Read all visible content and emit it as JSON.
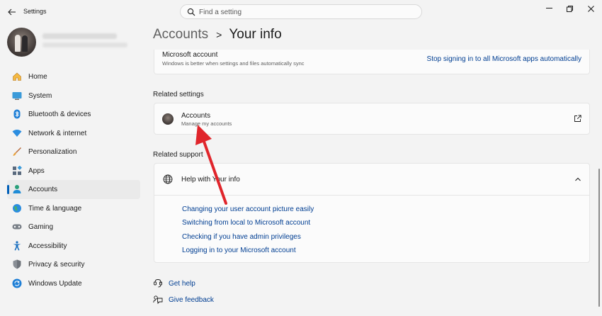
{
  "window": {
    "title": "Settings"
  },
  "search": {
    "placeholder": "Find a setting"
  },
  "sidebar": {
    "items": [
      {
        "label": "Home",
        "icon": "home-icon"
      },
      {
        "label": "System",
        "icon": "system-icon"
      },
      {
        "label": "Bluetooth & devices",
        "icon": "bluetooth-icon"
      },
      {
        "label": "Network & internet",
        "icon": "network-icon"
      },
      {
        "label": "Personalization",
        "icon": "brush-icon"
      },
      {
        "label": "Apps",
        "icon": "apps-icon"
      },
      {
        "label": "Accounts",
        "icon": "accounts-icon",
        "active": true
      },
      {
        "label": "Time & language",
        "icon": "time-language-icon"
      },
      {
        "label": "Gaming",
        "icon": "gaming-icon"
      },
      {
        "label": "Accessibility",
        "icon": "accessibility-icon"
      },
      {
        "label": "Privacy & security",
        "icon": "shield-icon"
      },
      {
        "label": "Windows Update",
        "icon": "update-icon"
      }
    ]
  },
  "breadcrumb": {
    "parent": "Accounts",
    "separator": ">",
    "current": "Your info"
  },
  "microsoft_account": {
    "title": "Microsoft account",
    "description": "Windows is better when settings and files automatically sync",
    "link": "Stop signing in to all Microsoft apps automatically"
  },
  "related_settings": {
    "heading": "Related settings",
    "accounts_card": {
      "title": "Accounts",
      "subtitle": "Manage my accounts"
    }
  },
  "related_support": {
    "heading": "Related support",
    "help": {
      "title": "Help with Your info",
      "links": [
        "Changing your user account picture easily",
        "Switching from local to Microsoft account",
        "Checking if you have admin privileges",
        "Logging in to your Microsoft account"
      ]
    }
  },
  "footer": {
    "get_help": "Get help",
    "give_feedback": "Give feedback"
  },
  "colors": {
    "accent": "#005fb8",
    "link": "#003e92",
    "annotation_arrow": "#e0252b"
  }
}
